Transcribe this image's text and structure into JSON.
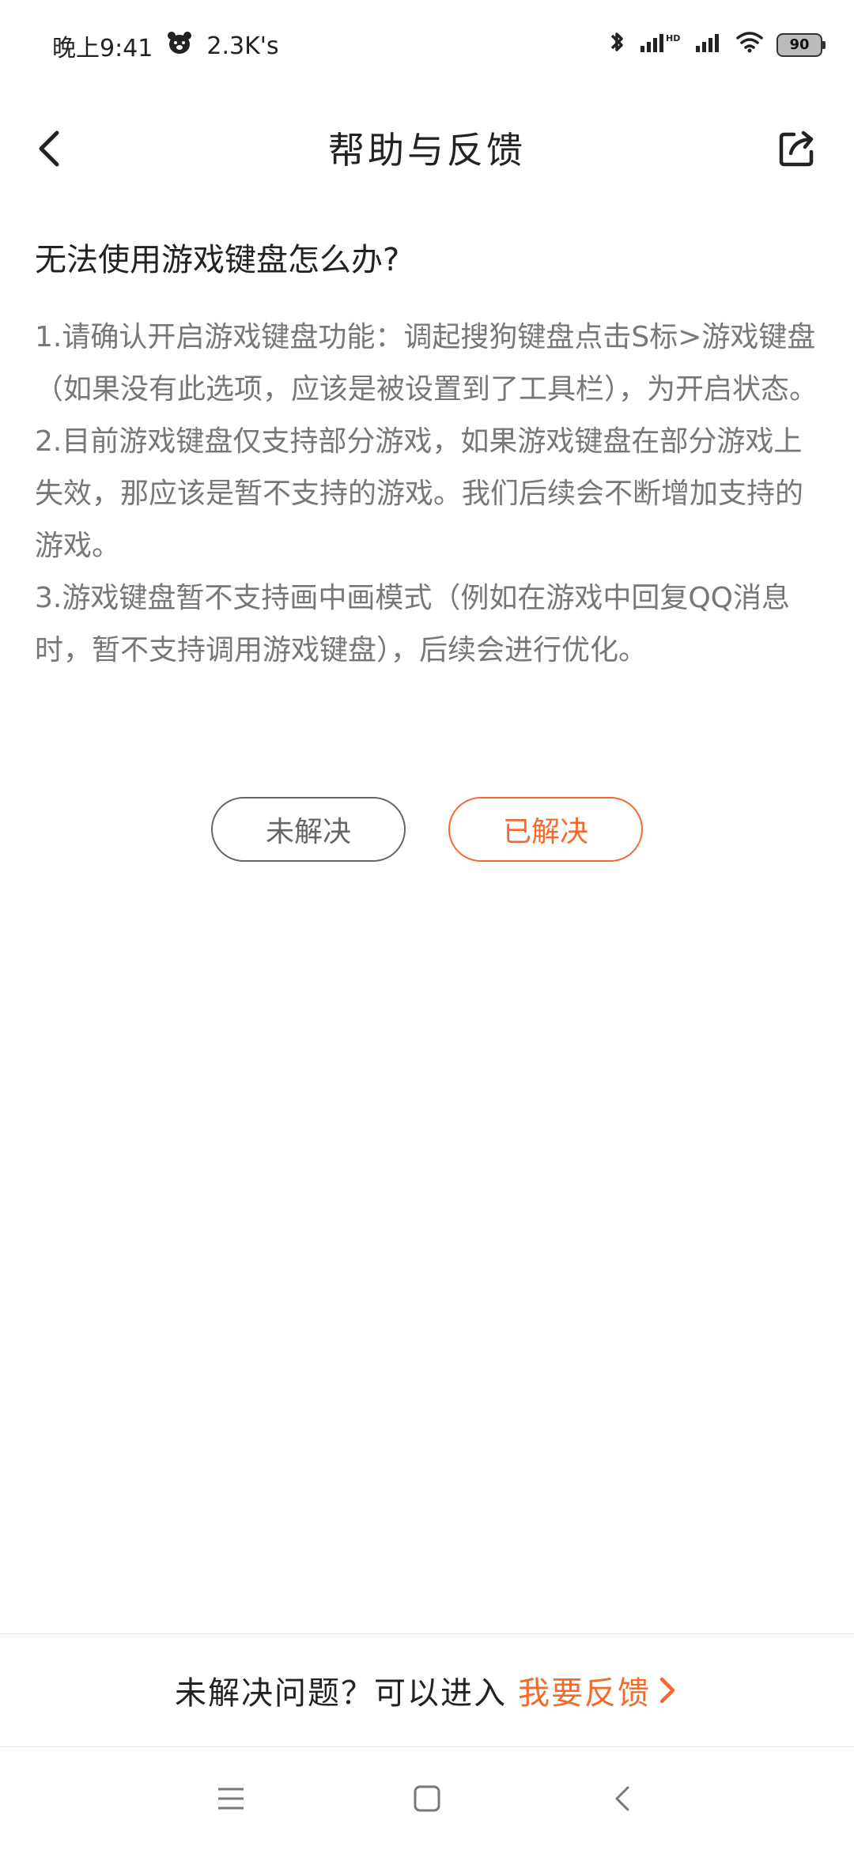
{
  "status_bar": {
    "time": "晚上9:41",
    "network_speed": "2.3K's",
    "battery": "90"
  },
  "header": {
    "title": "帮助与反馈"
  },
  "article": {
    "question": "无法使用游戏键盘怎么办?",
    "paragraphs": [
      "1.请确认开启游戏键盘功能：调起搜狗键盘点击S标>游戏键盘（如果没有此选项，应该是被设置到了工具栏），为开启状态。",
      "2.目前游戏键盘仅支持部分游戏，如果游戏键盘在部分游戏上失效，那应该是暂不支持的游戏。我们后续会不断增加支持的游戏。",
      "3.游戏键盘暂不支持画中画模式（例如在游戏中回复QQ消息时，暂不支持调用游戏键盘），后续会进行优化。"
    ]
  },
  "actions": {
    "unsolved_label": "未解决",
    "solved_label": "已解决"
  },
  "footer": {
    "prompt": "未解决问题？可以进入",
    "link_label": "我要反馈"
  },
  "colors": {
    "accent": "#f26a2c",
    "text_primary": "#222222",
    "text_secondary": "#777777"
  },
  "icons": {
    "back": "chevron-left-icon",
    "share": "share-icon",
    "nav_menu": "menu-icon",
    "nav_home": "home-icon",
    "nav_back": "back-icon"
  }
}
